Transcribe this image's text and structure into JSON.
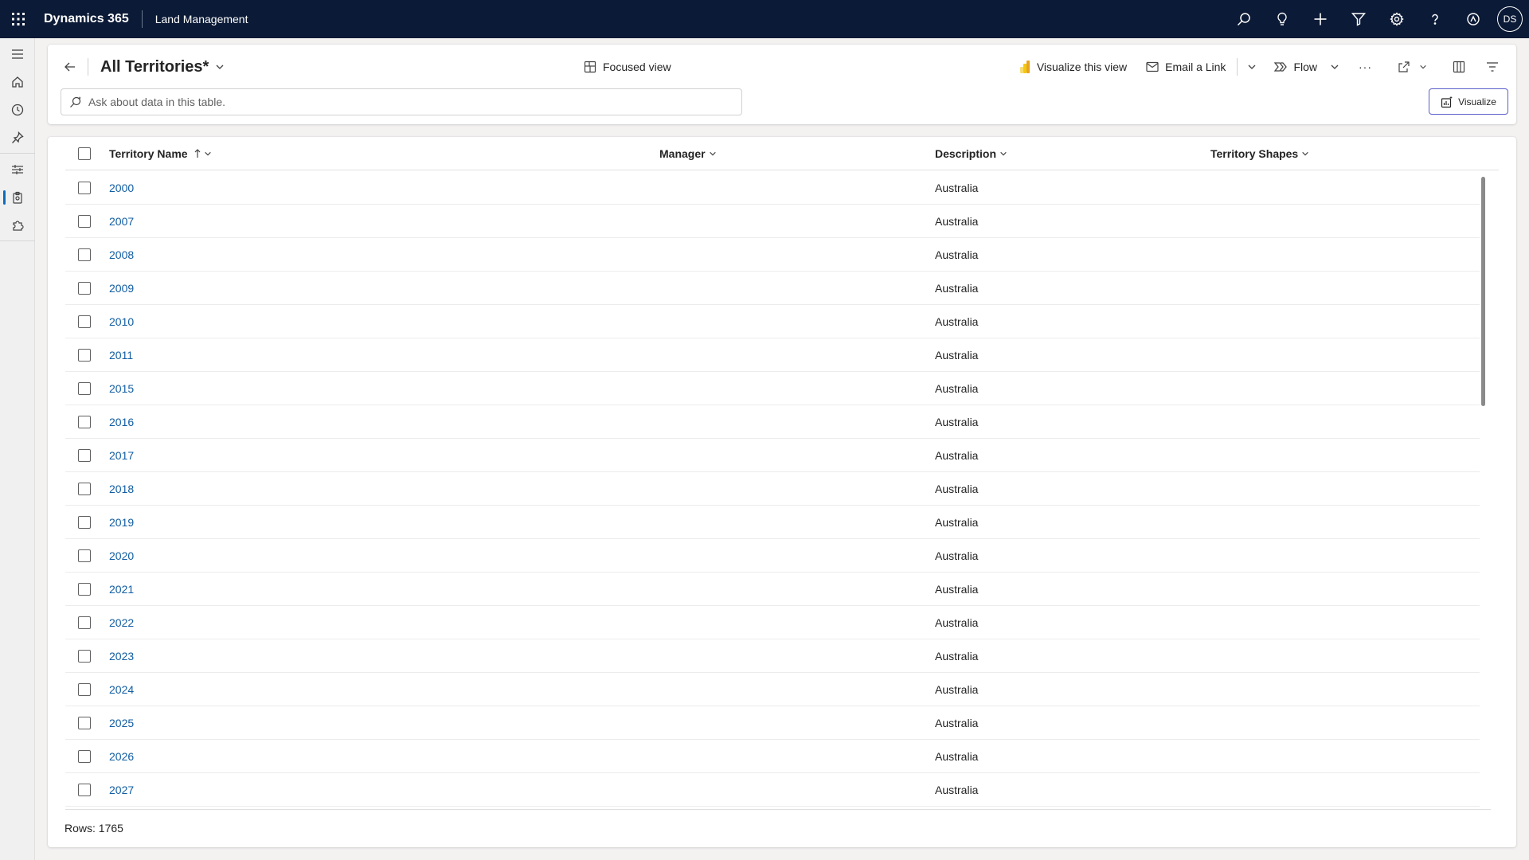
{
  "topbar": {
    "brand": "Dynamics 365",
    "app_name": "Land Management",
    "avatar_initials": "DS",
    "icons": [
      "search-icon",
      "lightbulb-icon",
      "plus-icon",
      "filter-icon",
      "gear-icon",
      "help-icon",
      "copilot-icon"
    ]
  },
  "leftnav": {
    "items": [
      "menu-icon",
      "home-icon",
      "recent-icon",
      "pin-icon",
      "territories-icon",
      "land-icon",
      "puzzle-icon"
    ]
  },
  "header": {
    "title": "All Territories*",
    "focused_view_label": "Focused view",
    "visualize_view_label": "Visualize this view",
    "email_link_label": "Email a Link",
    "flow_label": "Flow",
    "more_label": "···",
    "ask_placeholder": "Ask about data in this table.",
    "visualize_button_label": "Visualize"
  },
  "grid": {
    "columns": [
      {
        "label": "Territory Name",
        "sort": "ascending"
      },
      {
        "label": "Manager"
      },
      {
        "label": "Description"
      },
      {
        "label": "Territory Shapes"
      }
    ],
    "rows": [
      {
        "name": "2000",
        "manager": "",
        "description": "Australia",
        "shapes": ""
      },
      {
        "name": "2007",
        "manager": "",
        "description": "Australia",
        "shapes": ""
      },
      {
        "name": "2008",
        "manager": "",
        "description": "Australia",
        "shapes": ""
      },
      {
        "name": "2009",
        "manager": "",
        "description": "Australia",
        "shapes": ""
      },
      {
        "name": "2010",
        "manager": "",
        "description": "Australia",
        "shapes": ""
      },
      {
        "name": "2011",
        "manager": "",
        "description": "Australia",
        "shapes": ""
      },
      {
        "name": "2015",
        "manager": "",
        "description": "Australia",
        "shapes": ""
      },
      {
        "name": "2016",
        "manager": "",
        "description": "Australia",
        "shapes": ""
      },
      {
        "name": "2017",
        "manager": "",
        "description": "Australia",
        "shapes": ""
      },
      {
        "name": "2018",
        "manager": "",
        "description": "Australia",
        "shapes": ""
      },
      {
        "name": "2019",
        "manager": "",
        "description": "Australia",
        "shapes": ""
      },
      {
        "name": "2020",
        "manager": "",
        "description": "Australia",
        "shapes": ""
      },
      {
        "name": "2021",
        "manager": "",
        "description": "Australia",
        "shapes": ""
      },
      {
        "name": "2022",
        "manager": "",
        "description": "Australia",
        "shapes": ""
      },
      {
        "name": "2023",
        "manager": "",
        "description": "Australia",
        "shapes": ""
      },
      {
        "name": "2024",
        "manager": "",
        "description": "Australia",
        "shapes": ""
      },
      {
        "name": "2025",
        "manager": "",
        "description": "Australia",
        "shapes": ""
      },
      {
        "name": "2026",
        "manager": "",
        "description": "Australia",
        "shapes": ""
      },
      {
        "name": "2027",
        "manager": "",
        "description": "Australia",
        "shapes": ""
      }
    ],
    "row_count_label": "Rows: 1765"
  },
  "colors": {
    "topbar_bg": "#0b1a36",
    "link": "#115ea3",
    "accent": "#0f6cbd",
    "visualize_border": "#5b5fc7"
  }
}
